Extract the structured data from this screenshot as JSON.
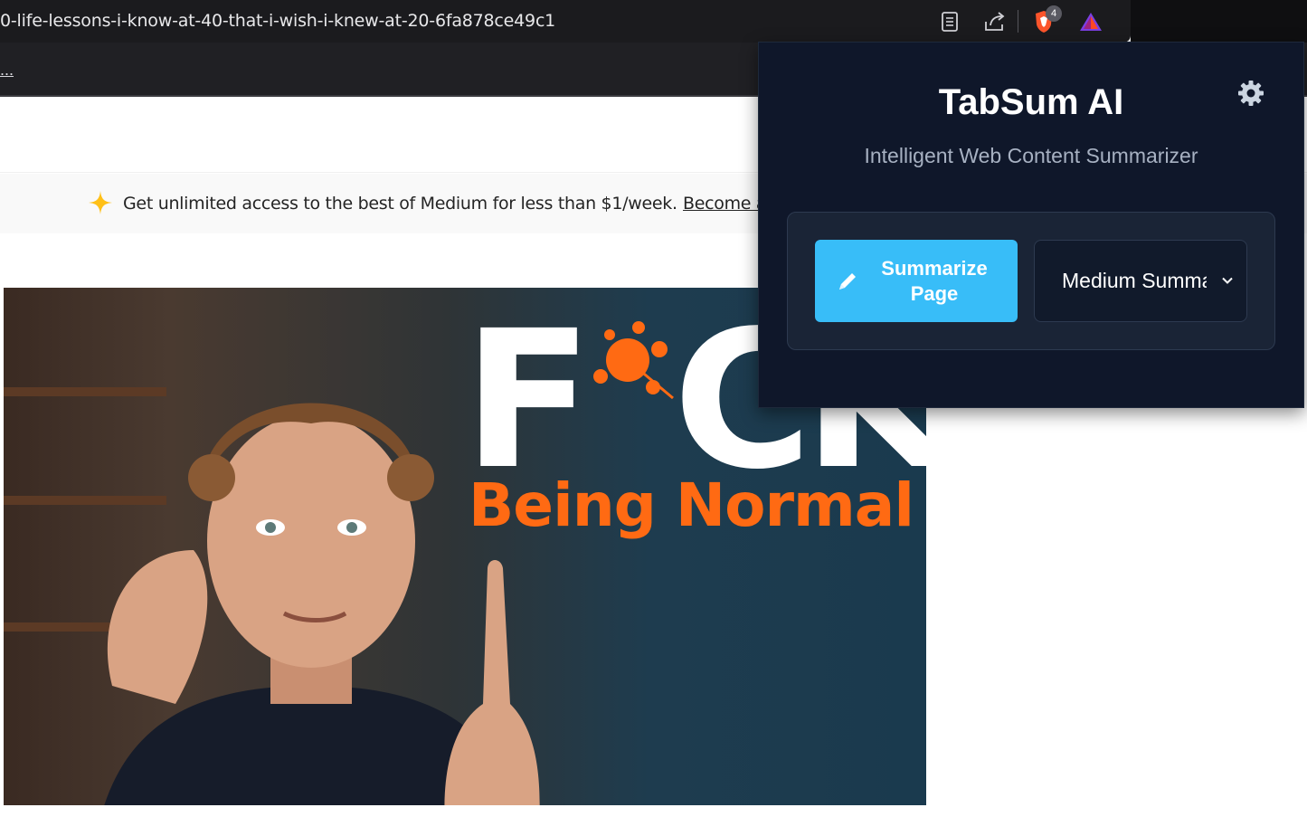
{
  "browser": {
    "url": "0-life-lessons-i-know-at-40-that-i-wish-i-knew-at-20-6fa878ce49c1",
    "bookmarks_overflow": "...",
    "brave_shields_count": "4",
    "icons": [
      "reader-mode-icon",
      "share-icon",
      "brave-shields-icon",
      "brave-rewards-icon",
      "tabsum-extension-icon"
    ]
  },
  "page": {
    "promo_text": "Get unlimited access to the best of Medium for less than $1/week.",
    "promo_link": "Become a",
    "hero": {
      "word_f": "F",
      "word_ck": "CK",
      "subtitle": "Being Normal",
      "subtitle_color": "#ff6a13"
    }
  },
  "popup": {
    "title": "TabSum AI",
    "subtitle": "Intelligent Web Content Summarizer",
    "summarize_button": "Summarize Page",
    "summary_mode_selected": "Medium Summary",
    "accent_color": "#38bdf8",
    "background_color": "#0f172a"
  }
}
